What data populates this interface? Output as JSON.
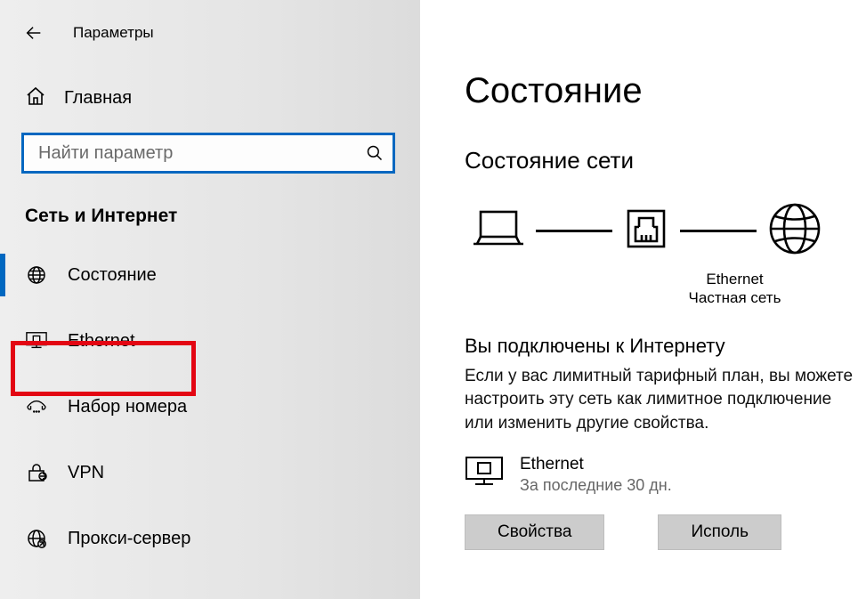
{
  "window_title": "Параметры",
  "home_label": "Главная",
  "search_placeholder": "Найти параметр",
  "section_label": "Сеть и Интернет",
  "nav": {
    "status": "Состояние",
    "ethernet": "Ethernet",
    "dialup": "Набор номера",
    "vpn": "VPN",
    "proxy": "Прокси-сервер"
  },
  "main": {
    "page_title": "Состояние",
    "sub_title": "Состояние сети",
    "diagram": {
      "adapter_name": "Ethernet",
      "network_type": "Частная сеть"
    },
    "connected_heading": "Вы подключены к Интернету",
    "connected_text": "Если у вас лимитный тарифный план, вы можете настроить эту сеть как лимитное подключение или изменить другие свойства.",
    "connection": {
      "name": "Ethernet",
      "sub": "За последние 30 дн."
    },
    "buttons": {
      "properties": "Свойства",
      "usage": "Исполь"
    }
  }
}
